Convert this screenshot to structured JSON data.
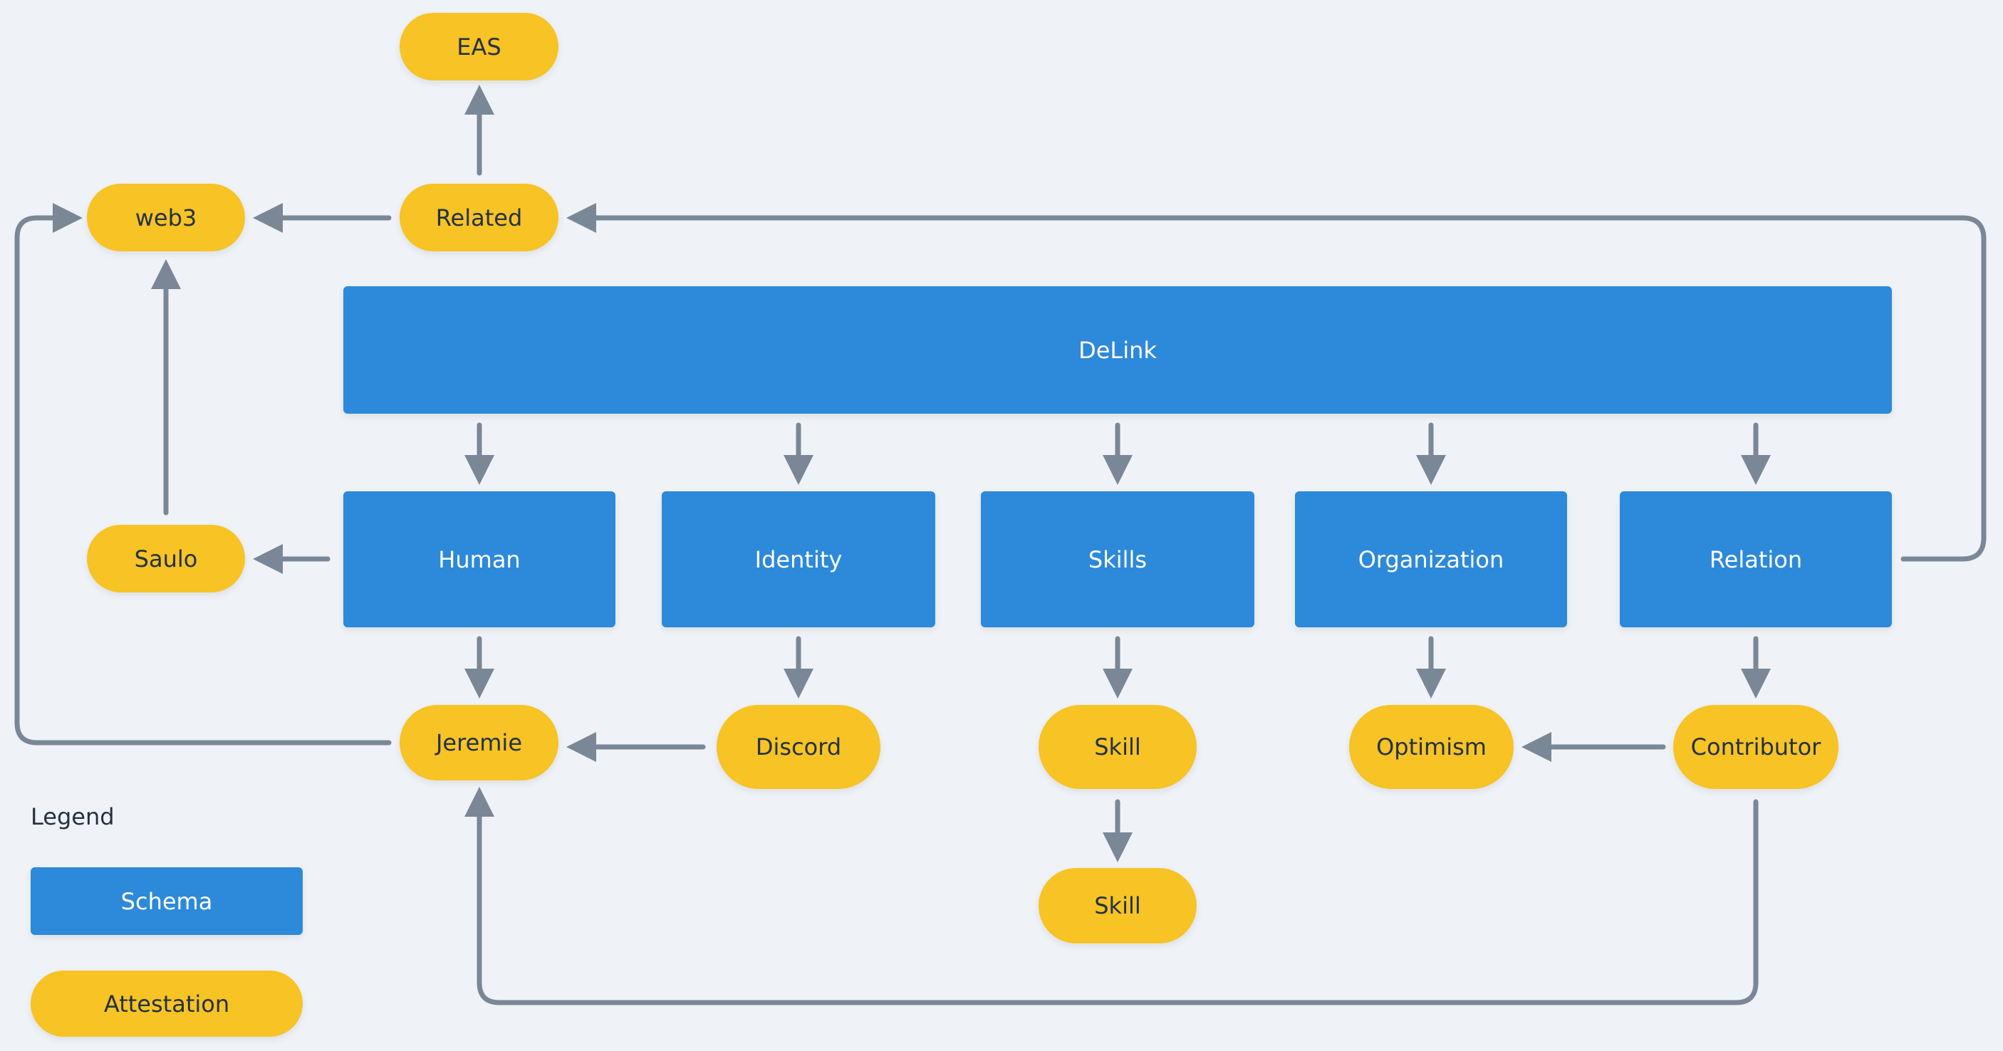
{
  "colors": {
    "schema": "#2d89d9",
    "attestation": "#f7c325",
    "edge": "#7a8796",
    "background": "#eff3f7",
    "text_dark": "#233141"
  },
  "nodes": {
    "eas": {
      "label": "EAS",
      "kind": "attestation"
    },
    "web3": {
      "label": "web3",
      "kind": "attestation"
    },
    "related": {
      "label": "Related",
      "kind": "attestation"
    },
    "delink": {
      "label": "DeLink",
      "kind": "schema"
    },
    "human": {
      "label": "Human",
      "kind": "schema"
    },
    "identity": {
      "label": "Identity",
      "kind": "schema"
    },
    "skills": {
      "label": "Skills",
      "kind": "schema"
    },
    "organization": {
      "label": "Organization",
      "kind": "schema"
    },
    "relation": {
      "label": "Relation",
      "kind": "schema"
    },
    "saulo": {
      "label": "Saulo",
      "kind": "attestation"
    },
    "jeremie": {
      "label": "Jeremie",
      "kind": "attestation"
    },
    "discord": {
      "label": "Discord",
      "kind": "attestation"
    },
    "skill_1": {
      "label": "Skill",
      "kind": "attestation"
    },
    "skill_2": {
      "label": "Skill",
      "kind": "attestation"
    },
    "optimism": {
      "label": "Optimism",
      "kind": "attestation"
    },
    "contributor": {
      "label": "Contributor",
      "kind": "attestation"
    }
  },
  "edges": [
    {
      "from": "related",
      "to": "eas"
    },
    {
      "from": "related",
      "to": "web3"
    },
    {
      "from": "relation",
      "to": "related"
    },
    {
      "from": "saulo",
      "to": "web3"
    },
    {
      "from": "jeremie",
      "to": "web3"
    },
    {
      "from": "delink",
      "to": "human"
    },
    {
      "from": "delink",
      "to": "identity"
    },
    {
      "from": "delink",
      "to": "skills"
    },
    {
      "from": "delink",
      "to": "organization"
    },
    {
      "from": "delink",
      "to": "relation"
    },
    {
      "from": "human",
      "to": "saulo"
    },
    {
      "from": "human",
      "to": "jeremie"
    },
    {
      "from": "identity",
      "to": "discord"
    },
    {
      "from": "discord",
      "to": "jeremie"
    },
    {
      "from": "skills",
      "to": "skill_1"
    },
    {
      "from": "skill_1",
      "to": "skill_2"
    },
    {
      "from": "organization",
      "to": "optimism"
    },
    {
      "from": "relation",
      "to": "contributor"
    },
    {
      "from": "contributor",
      "to": "optimism"
    },
    {
      "from": "contributor",
      "to": "jeremie"
    }
  ],
  "legend": {
    "title": "Legend",
    "items": [
      {
        "label": "Schema",
        "kind": "schema"
      },
      {
        "label": "Attestation",
        "kind": "attestation"
      }
    ]
  }
}
